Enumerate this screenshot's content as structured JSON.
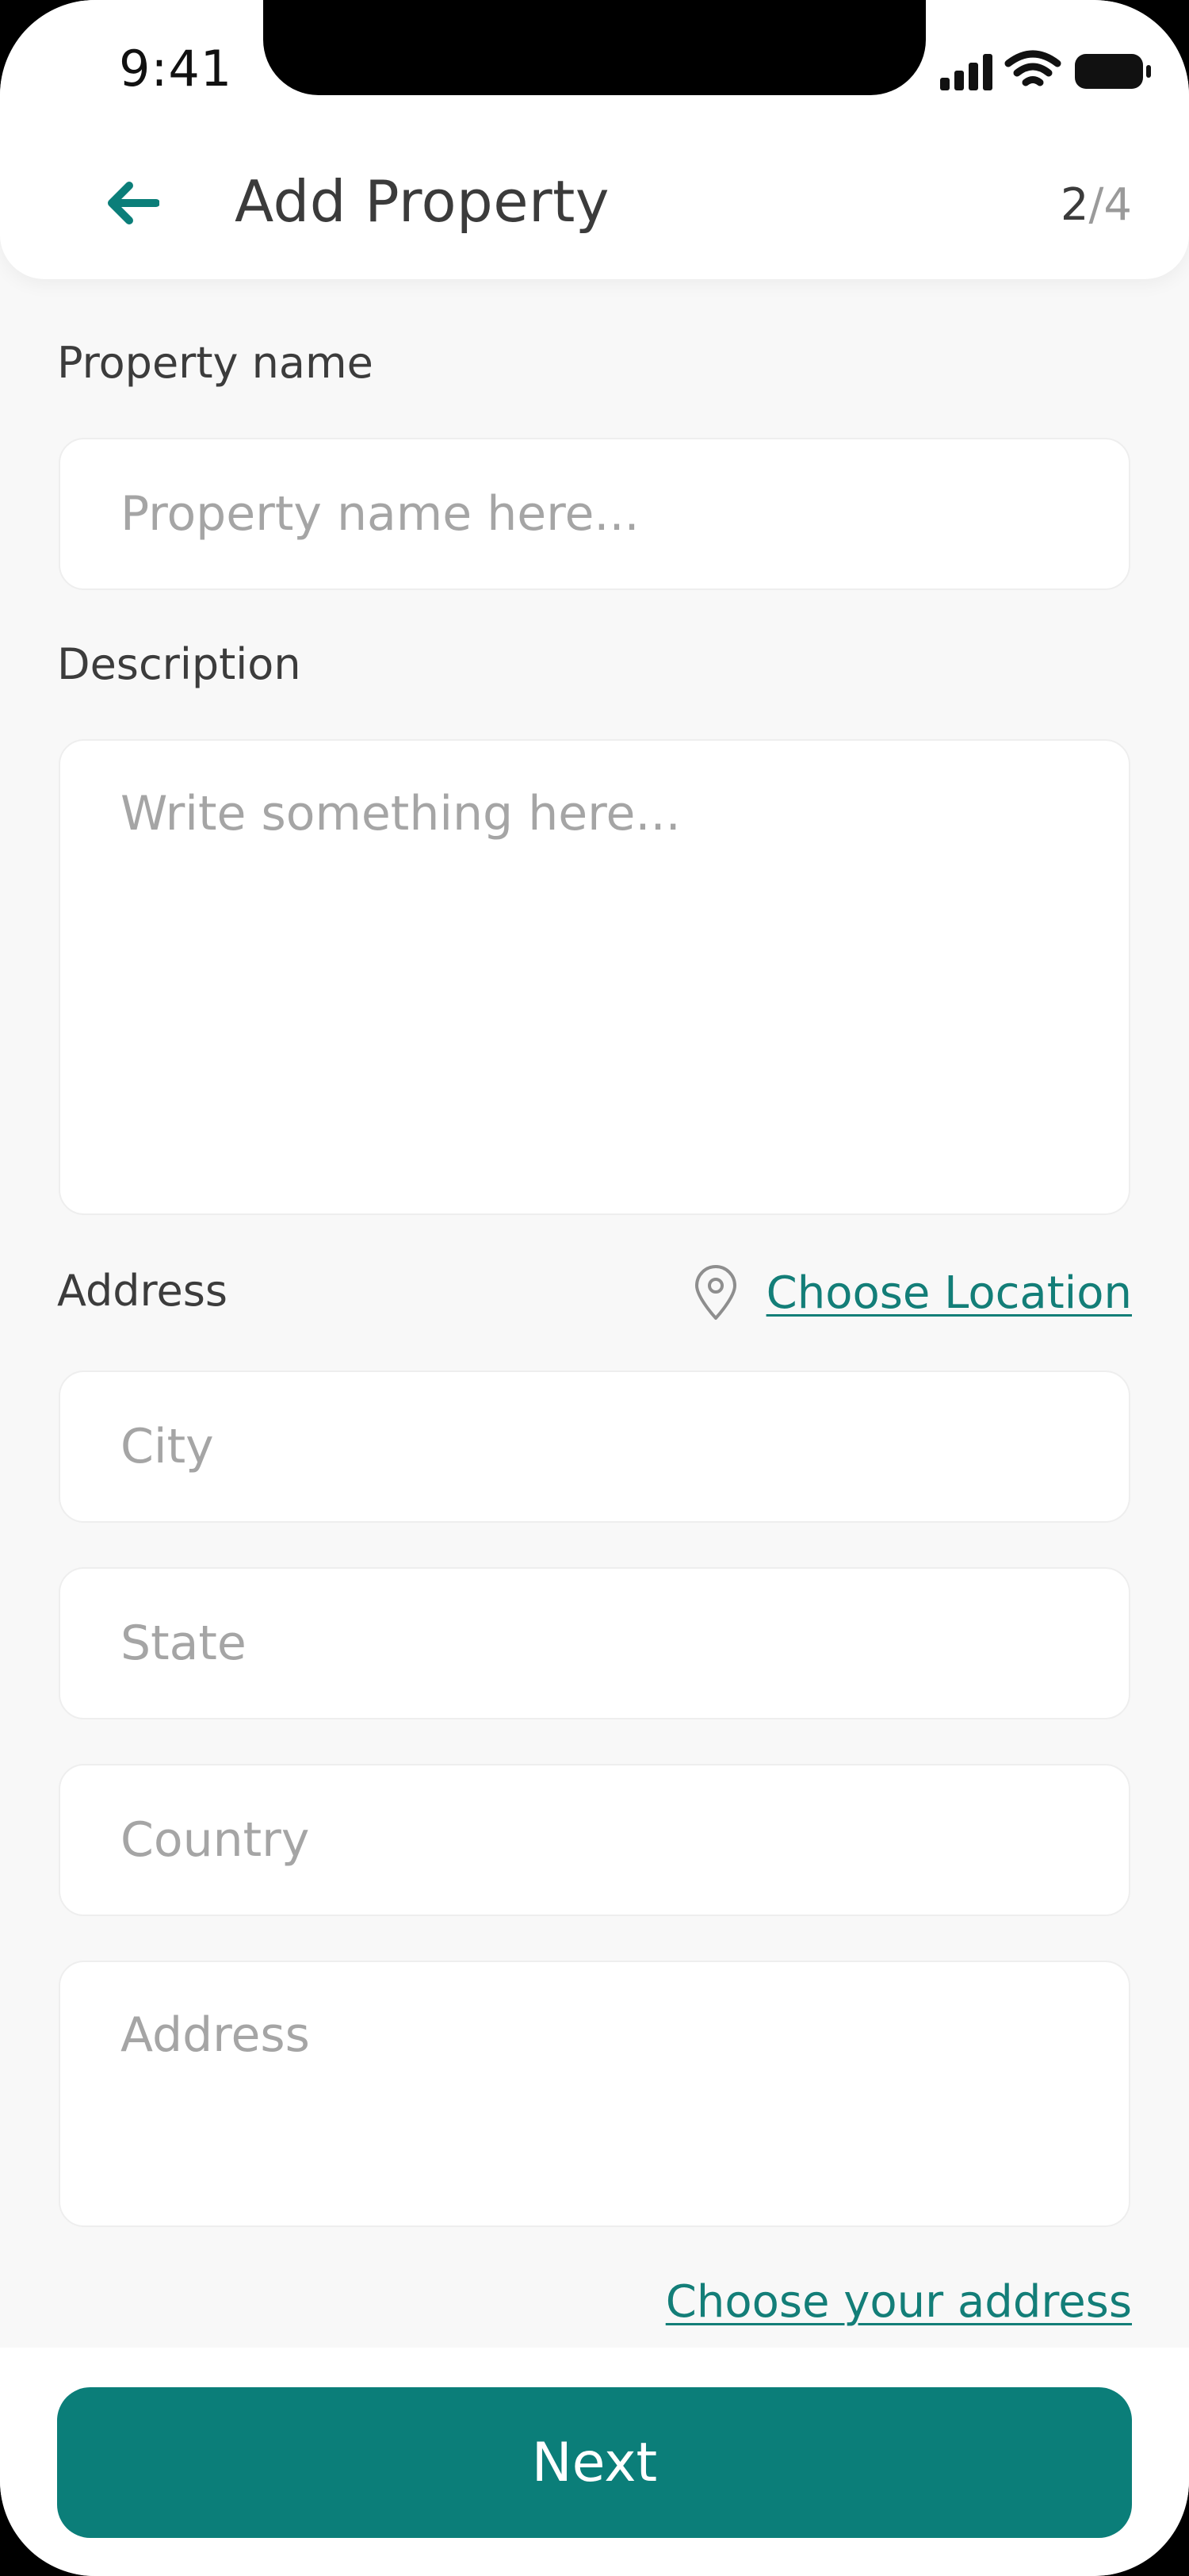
{
  "status_bar": {
    "time": "9:41",
    "icons": [
      "signal-icon",
      "wifi-icon",
      "battery-icon"
    ]
  },
  "app_bar": {
    "back_icon": "arrow-left-icon",
    "title": "Add Property",
    "step_current": "2",
    "step_total": "/4"
  },
  "form": {
    "property_name": {
      "label": "Property name",
      "placeholder": "Property name here...",
      "value": ""
    },
    "description": {
      "label": "Description",
      "placeholder": "Write something here...",
      "value": ""
    },
    "address_section": {
      "label": "Address",
      "location_icon": "map-pin-icon",
      "choose_location_label": "Choose Location",
      "city_placeholder": "City",
      "state_placeholder": "State",
      "country_placeholder": "Country",
      "address_placeholder": "Address",
      "choose_address_label": "Choose your address"
    }
  },
  "footer": {
    "next_label": "Next"
  },
  "colors": {
    "accent": "#0b7e79",
    "link": "#137e78",
    "background": "#f8f8f8",
    "placeholder": "#a5a5a5"
  }
}
